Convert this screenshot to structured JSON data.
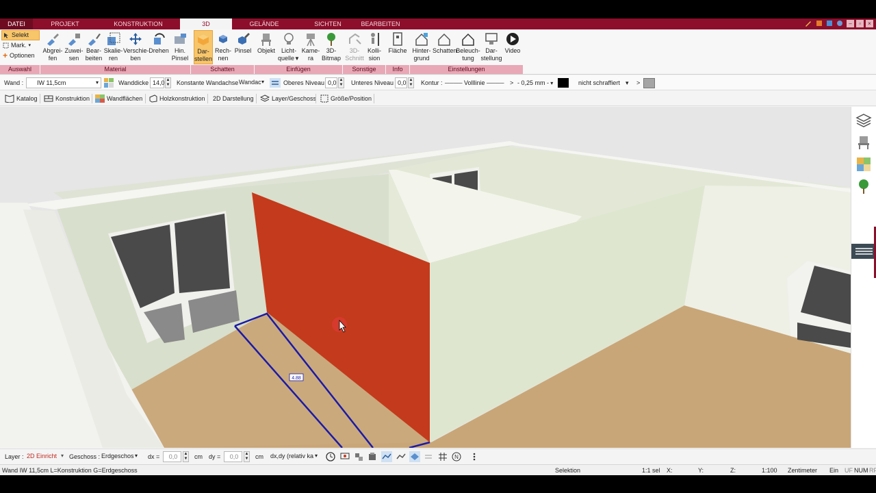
{
  "tabs": {
    "file": "DATEI",
    "project": "PROJEKT",
    "construction": "KONSTRUKTION",
    "view3d": "3D",
    "terrain": "GELÄNDE",
    "views": "SICHTEN",
    "edit": "BEARBEITEN"
  },
  "ribbon": {
    "left": {
      "select": "Selekt",
      "mark": "Mark.",
      "options": "Optionen"
    },
    "buttons": {
      "pick1": "Abgrei-",
      "pick2": "fen",
      "assign1": "Zuwei-",
      "assign2": "sen",
      "edit1": "Bear-",
      "edit2": "beiten",
      "scale1": "Skalie-",
      "scale2": "ren",
      "move1": "Verschie-",
      "move2": "ben",
      "rotate1": "Drehen",
      "bgbrush1": "Hin.",
      "bgbrush2": "Pinsel",
      "render1": "Dar-",
      "render2": "stellen",
      "calc1": "Rech-",
      "calc2": "nen",
      "brush1": "Pinsel",
      "object1": "Objekt",
      "light1": "Licht-",
      "light2": "quelle",
      "camera1": "Kame-",
      "camera2": "ra",
      "bitmap1": "3D-",
      "bitmap2": "Bitmap",
      "section1": "3D-",
      "section2": "Schnitt",
      "collision1": "Kolli-",
      "collision2": "sion",
      "area1": "Fläche",
      "background1": "Hinter-",
      "background2": "grund",
      "shadow1": "Schatten",
      "lighting1": "Beleuch-",
      "lighting2": "tung",
      "display1": "Dar-",
      "display2": "stellung",
      "video1": "Video"
    },
    "groups": {
      "selection": "Auswahl",
      "material": "Material",
      "shadows": "Schatten",
      "insert": "Einfügen",
      "other": "Sonstige",
      "info": "Info",
      "settings": "Einstellungen"
    }
  },
  "propbar": {
    "wall_label": "Wand :",
    "wall_type": "IW 11,5cm",
    "thickness_label": "Wanddicke",
    "thickness_value": "14,0",
    "axis_label": "Konstante Wandachse",
    "axis_value": "Wandac",
    "upper_label": "Oberes Niveau",
    "upper_value": "0,0",
    "lower_label": "Unteres Niveau",
    "lower_value": "0,0",
    "contour_label": "Kontur :",
    "line_type": "Volllinie",
    "arrow": ">",
    "line_width": "- 0,25 mm -",
    "hatch": "nicht schraffiert",
    "arrow2": ">"
  },
  "toolbar2": {
    "catalog": "Katalog",
    "construction": "Konstruktion",
    "wall_surfaces": "Wandflächen",
    "wood": "Holzkonstruktion",
    "view2d": "2D Darstellung",
    "layer": "Layer/Geschoss",
    "size": "Größe/Position"
  },
  "viewport": {
    "dimension_label": "4.88"
  },
  "bottombar": {
    "layer_label": "Layer :",
    "layer_value": "2D Einricht",
    "floor_label": "Geschoss :",
    "floor_value": "Erdgeschos",
    "dx_label": "dx =",
    "dx_value": "0,0",
    "dx_unit": "cm",
    "dy_label": "dy =",
    "dy_value": "0,0",
    "dy_unit": "cm",
    "mode_value": "dx,dy (relativ ka"
  },
  "statusbar": {
    "info": "Wand IW 11,5cm L=Konstruktion G=Erdgeschoss",
    "mode": "Selektion",
    "sel": "1:1 sel",
    "x": "X:",
    "y": "Y:",
    "z": "Z:",
    "scale": "1:100",
    "unit": "Zentimeter",
    "ein": "Ein",
    "uf": "UF",
    "num": "NUM",
    "rf": "RF"
  },
  "colors": {
    "brand": "#8c0e2a",
    "group_band": "#e9a8b6",
    "highlight": "#f7c56a",
    "red_wall": "#c43a1c",
    "dimension_line": "#1a1aa8"
  }
}
